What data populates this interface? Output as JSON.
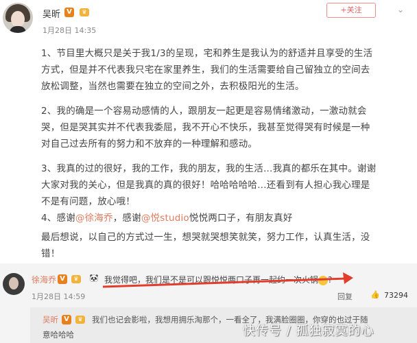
{
  "post": {
    "author": "吴昕",
    "verified_badge": "V",
    "level_badge": "Lv",
    "time": "1月28日 14:35",
    "follow_label": "+关注",
    "lines": [
      "1、节目里大概只是关于我1/3的呈现，宅和养生是我认为的舒适并且享受的生活",
      "方式，但是并不代表我只宅在家里养生，我们的生活需要给自己留独立的空间去",
      "放松调整，当然也需要在独立的空间之外，去积极阳光的生活。",
      "2、我的确是一个容易动感情的人，跟朋友一起更是容易情绪激动，一激动就会",
      "哭，但是哭其实并不代表我委屈，我不开心不快乐，我甚至觉得哭有时候是一种",
      "对自己过去所有的努力和不放弃的一种理解和感动。",
      "3、我真的过的很好，我的工作，我的朋友，我的生活…我真的都乐在其中。谢谢",
      "大家对我的关心，但是我真的真的很好！哈哈哈哈哈…还看到有人担心我心理是",
      "不是有问题，放心哦！",
      "4、感谢",
      "最后想说，以自己的方式过一生，想哭就哭想笑就笑，努力工作，认真生活，没",
      "错！"
    ],
    "line4_mention1": "@徐海乔",
    "line4_mid": "，感谢",
    "line4_mention2": "@悦studio",
    "line4_end": "悦悦两口子，有朋友真好"
  },
  "comment": {
    "author": "徐海乔",
    "text": "我觉得吧，我们是不是可以跟悦悦两口子再一起约一次火锅",
    "panda": "🐼",
    "time": "1月28日 14:59",
    "reply_label": "回复",
    "likes": "73294"
  },
  "reply": {
    "author": "吴昕",
    "text": "我们也记会影啦，我想用拥乐淘那个，一看全了，我满脸圈圈，你穿的也过于随",
    "text2": "意哈哈哈"
  },
  "watermark": "快传号 / 孤独寂寞的心",
  "colors": {
    "accent": "#e07b5f",
    "arrow": "#e23c2c",
    "badge": "#e8811c"
  }
}
